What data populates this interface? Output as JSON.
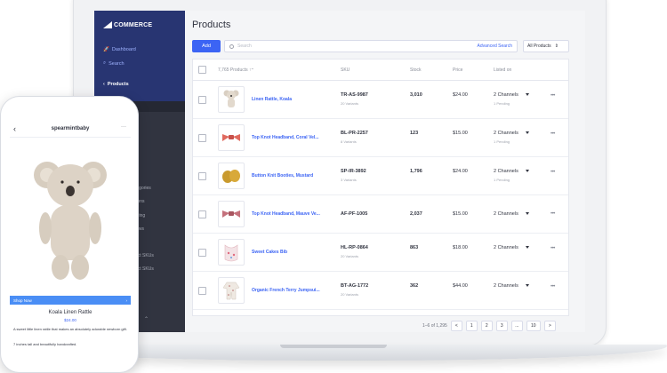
{
  "app": {
    "logo_text": "COMMERCE",
    "page_title": "Products"
  },
  "sidebar": {
    "dashboard": "Dashboard",
    "search": "Search",
    "products": "Products",
    "sub_items": [
      "tegories",
      "tions",
      "ering",
      "iews",
      "uct SKUs",
      "uct SKUs"
    ]
  },
  "toolbar": {
    "add_label": "Add",
    "search_placeholder": "Search",
    "advanced_search": "Advanced Search",
    "filter_value": "All Products"
  },
  "table": {
    "headers": {
      "products": "7,765 Products",
      "sku": "SKU",
      "stock": "Stock",
      "price": "Price",
      "listed_on": "Listed on"
    },
    "rows": [
      {
        "name": "Linen Rattle, Koala",
        "sku": "TR-AS-9987",
        "variants": "20 Variants",
        "stock": "3,010",
        "price": "$24.00",
        "channels": "2 Channels",
        "pending": "1 Pending"
      },
      {
        "name": "Top Knot Headband, Coral Vel...",
        "sku": "BL-PR-2257",
        "variants": "8 Variants",
        "stock": "123",
        "price": "$15.00",
        "channels": "2 Channels",
        "pending": "1 Pending"
      },
      {
        "name": "Button Knit Booties, Mustard",
        "sku": "SP-IR-3892",
        "variants": "3 Variants",
        "stock": "1,796",
        "price": "$24.00",
        "channels": "2 Channels",
        "pending": "1 Pending"
      },
      {
        "name": "Top Knot Headband, Mauve Ve...",
        "sku": "AF-PF-1005",
        "variants": "",
        "stock": "2,037",
        "price": "$15.00",
        "channels": "2 Channels",
        "pending": ""
      },
      {
        "name": "Sweet Cakes Bib",
        "sku": "HL-RP-0864",
        "variants": "20 Variants",
        "stock": "863",
        "price": "$18.00",
        "channels": "2 Channels",
        "pending": ""
      },
      {
        "name": "Organic French Terry Jumpsui...",
        "sku": "BT-AG-1772",
        "variants": "20 Variants",
        "stock": "362",
        "price": "$44.00",
        "channels": "2 Channels",
        "pending": ""
      }
    ]
  },
  "pagination": {
    "range": "1–6 of 1,295",
    "pages": [
      "1",
      "2",
      "3",
      "...",
      "10"
    ],
    "prev": "<",
    "next": ">"
  },
  "phone": {
    "store_name": "spearmintbaby",
    "shop_now": "Shop Now",
    "product_title": "Koala Linen Rattle",
    "product_price": "$24.00",
    "description": "A sweet little linen rattle that makes an absolutely adorable newborn gift.",
    "description2": "7 inches tall and beautifully handcrafted."
  }
}
